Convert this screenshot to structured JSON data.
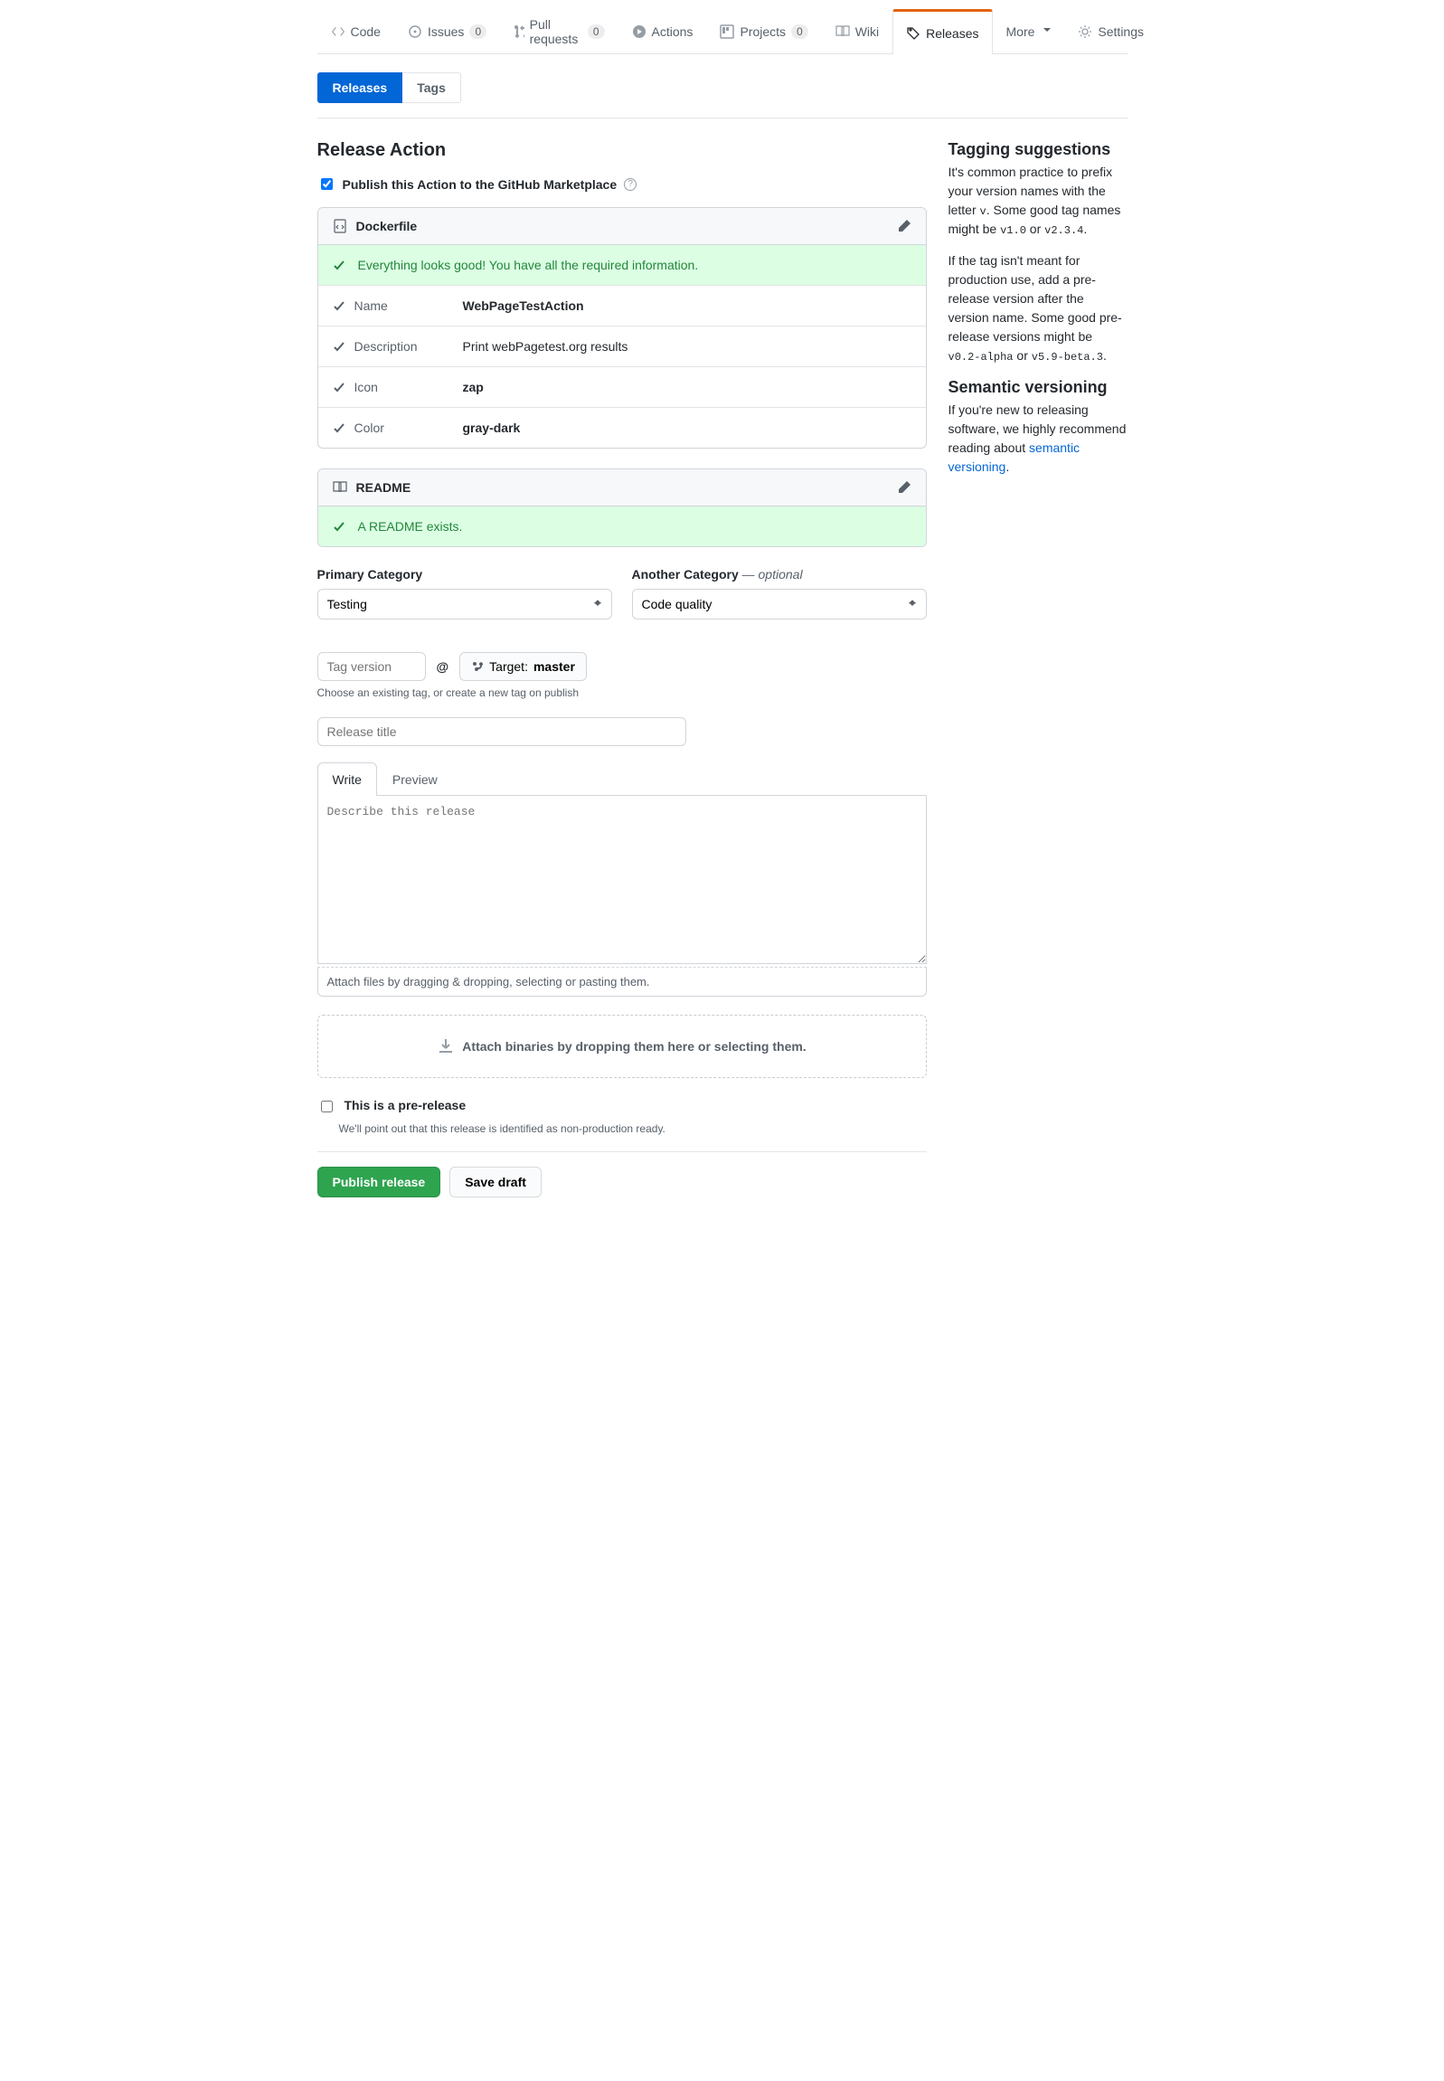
{
  "reponav": {
    "code": "Code",
    "issues": "Issues",
    "issues_count": "0",
    "prs": "Pull requests",
    "prs_count": "0",
    "actions": "Actions",
    "projects": "Projects",
    "projects_count": "0",
    "wiki": "Wiki",
    "releases": "Releases",
    "more": "More",
    "settings": "Settings"
  },
  "subnav": {
    "releases": "Releases",
    "tags": "Tags"
  },
  "page_title": "Release Action",
  "publish_label": "Publish this Action to the GitHub Marketplace",
  "dockerfile": {
    "header": "Dockerfile",
    "success": "Everything looks good! You have all the required information.",
    "rows": [
      {
        "label": "Name",
        "value": "WebPageTestAction",
        "bold": true
      },
      {
        "label": "Description",
        "value": "Print webPagetest.org results",
        "bold": false
      },
      {
        "label": "Icon",
        "value": "zap",
        "bold": true
      },
      {
        "label": "Color",
        "value": "gray-dark",
        "bold": true
      }
    ]
  },
  "readme": {
    "header": "README",
    "success": "A README exists."
  },
  "categories": {
    "primary_label": "Primary Category",
    "primary_value": "Testing",
    "another_label": "Another Category",
    "another_opt": " — optional",
    "another_value": "Code quality"
  },
  "tag": {
    "placeholder": "Tag version",
    "at": "@",
    "target_prefix": "Target:",
    "target_branch": "master",
    "hint": "Choose an existing tag, or create a new tag on publish"
  },
  "title_placeholder": "Release title",
  "tabs": {
    "write": "Write",
    "preview": "Preview"
  },
  "desc_placeholder": "Describe this release",
  "attach_hint": "Attach files by dragging & dropping, selecting or pasting them.",
  "dropzone": "Attach binaries by dropping them here or selecting them.",
  "prerelease": {
    "label": "This is a pre-release",
    "note": "We'll point out that this release is identified as non-production ready."
  },
  "buttons": {
    "publish": "Publish release",
    "draft": "Save draft"
  },
  "side": {
    "h1": "Tagging suggestions",
    "p1a": "It's common practice to prefix your version names with the letter ",
    "p1b": ". Some good tag names might be ",
    "p1c": " or ",
    "p1d": ".",
    "v": "v",
    "t1": "v1.0",
    "t2": "v2.3.4",
    "p2a": "If the tag isn't meant for production use, add a pre-release version after the version name. Some good pre-release versions might be ",
    "p2b": " or ",
    "p2c": ".",
    "t3": "v0.2-alpha",
    "t4": "v5.9-beta.3",
    "h2": "Semantic versioning",
    "p3a": "If you're new to releasing software, we highly recommend reading about ",
    "link": "semantic versioning",
    "p3b": "."
  }
}
